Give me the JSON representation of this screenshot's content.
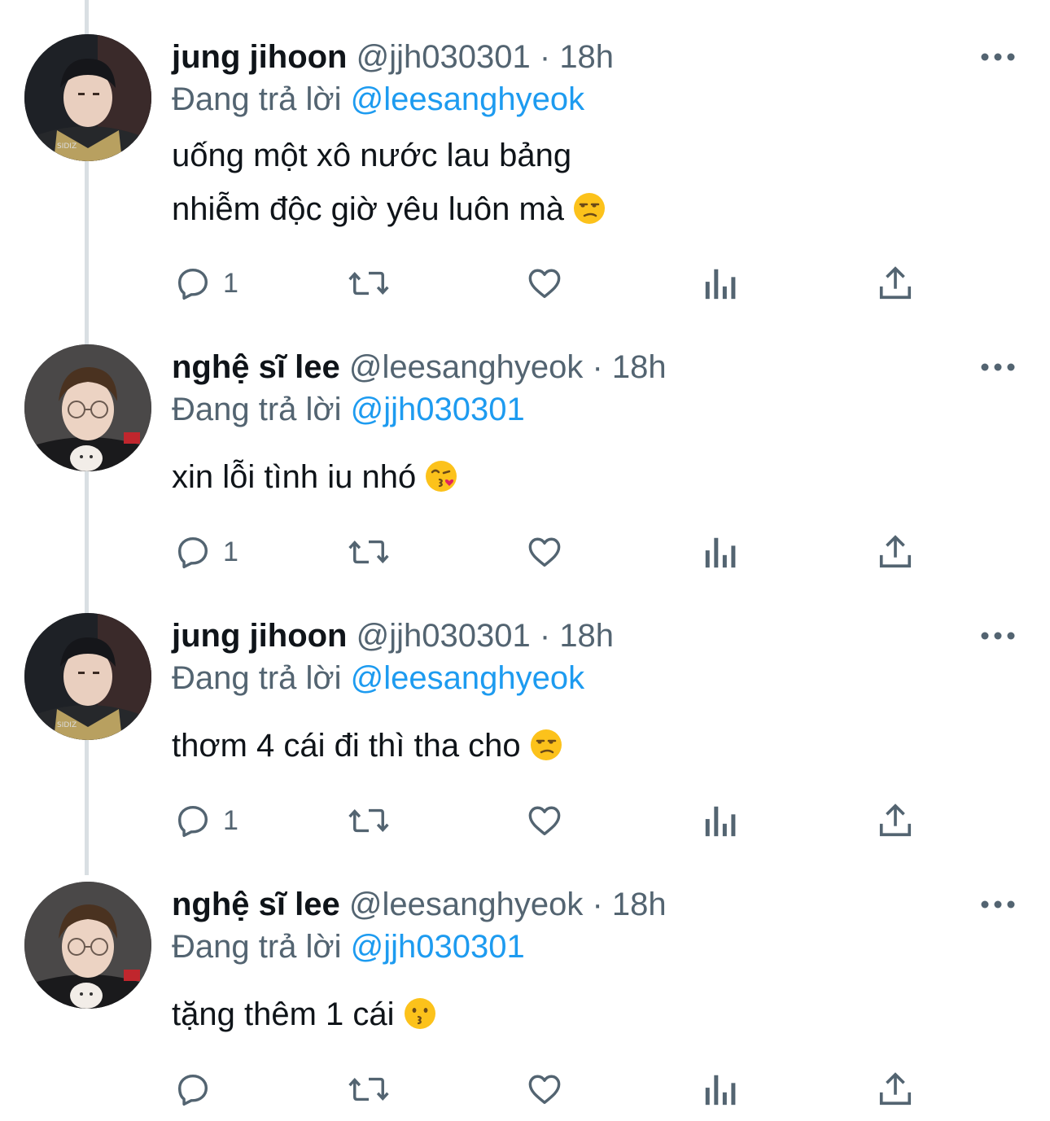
{
  "colors": {
    "text_primary": "#0f1419",
    "text_secondary": "#536471",
    "link": "#1d9bf0",
    "thread_line": "#d9dfe3"
  },
  "tweets": [
    {
      "author": "jung jihoon",
      "handle": "@jjh030301",
      "dot": "·",
      "time": "18h",
      "reply_prefix": "Đang trả lời",
      "reply_to": "@leesanghyeok",
      "lines": [
        "uống một xô nước lau bảng",
        "nhiễm độc giờ yêu luôn mà"
      ],
      "emoji": "unamused-face-emoji",
      "reply_count": "1",
      "avatar": "avatar-jung-jihoon"
    },
    {
      "author": "nghệ sĩ lee",
      "handle": "@leesanghyeok",
      "dot": "·",
      "time": "18h",
      "reply_prefix": "Đang trả lời",
      "reply_to": "@jjh030301",
      "lines": [
        "xin lỗi tình iu nhó"
      ],
      "emoji": "face-blowing-kiss-emoji",
      "reply_count": "1",
      "avatar": "avatar-nghe-si-lee"
    },
    {
      "author": "jung jihoon",
      "handle": "@jjh030301",
      "dot": "·",
      "time": "18h",
      "reply_prefix": "Đang trả lời",
      "reply_to": "@leesanghyeok",
      "lines": [
        "thơm 4 cái đi thì tha cho"
      ],
      "emoji": "unamused-face-emoji",
      "reply_count": "1",
      "avatar": "avatar-jung-jihoon"
    },
    {
      "author": "nghệ sĩ lee",
      "handle": "@leesanghyeok",
      "dot": "·",
      "time": "18h",
      "reply_prefix": "Đang trả lời",
      "reply_to": "@jjh030301",
      "lines": [
        "tặng thêm 1 cái"
      ],
      "emoji": "kissing-face-emoji",
      "reply_count": "",
      "avatar": "avatar-nghe-si-lee"
    }
  ],
  "action_icons": [
    "reply-icon",
    "retweet-icon",
    "like-icon",
    "views-icon",
    "share-icon"
  ]
}
